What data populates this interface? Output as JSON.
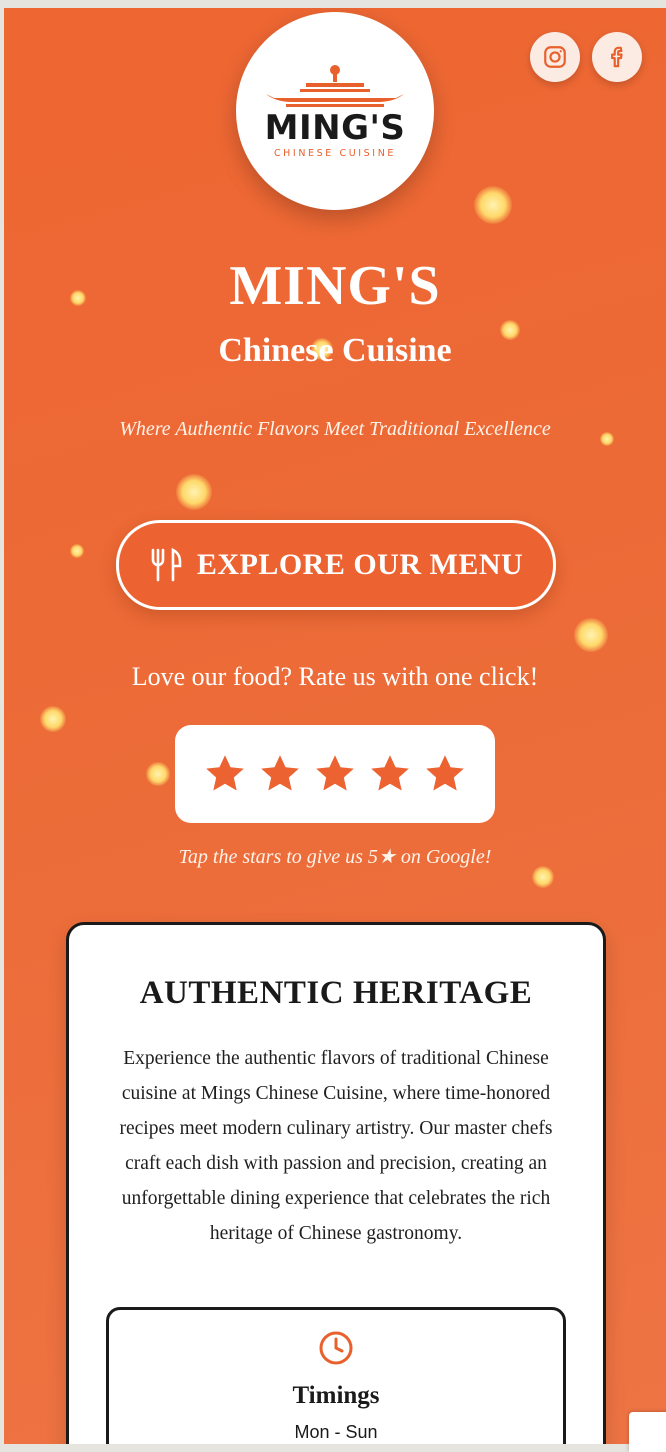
{
  "social": {
    "instagram_icon": "instagram-icon",
    "facebook_icon": "facebook-icon"
  },
  "logo": {
    "word": "MING'S",
    "sub": "CHINESE CUISINE"
  },
  "hero": {
    "title": "MING'S",
    "subtitle": "Chinese Cuisine",
    "tagline": "Where Authentic Flavors Meet Traditional Excellence"
  },
  "menu_button": {
    "icon": "utensils-icon",
    "label": "EXPLORE OUR MENU"
  },
  "rating": {
    "prompt": "Love our food? Rate us with one click!",
    "stars": 5,
    "hint": "Tap the stars to give us 5★ on Google!"
  },
  "heritage": {
    "title": "AUTHENTIC HERITAGE",
    "body": "Experience the authentic flavors of traditional Chinese cuisine at Mings Chinese Cuisine, where time-honored recipes meet modern culinary artistry. Our master chefs craft each dish with passion and precision, creating an unforgettable dining experience that celebrates the rich heritage of Chinese gastronomy."
  },
  "timings": {
    "icon": "clock-icon",
    "title": "Timings",
    "days": "Mon - Sun"
  },
  "colors": {
    "accent": "#ec6230",
    "background": "#ee6a36",
    "text_dark": "#1a1a1a"
  }
}
